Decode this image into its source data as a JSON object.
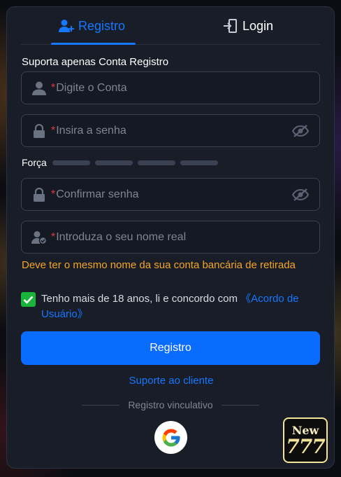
{
  "tabs": [
    {
      "label": "Registro",
      "icon": "user-add-icon",
      "active": true
    },
    {
      "label": "Login",
      "icon": "login-door-icon",
      "active": false
    }
  ],
  "form": {
    "section_label": "Suporta apenas Conta Registro",
    "required_mark": "*",
    "account_placeholder": "Digite o Conta",
    "password_placeholder": "Insira a senha",
    "strength_label": "Força",
    "confirm_placeholder": "Confirmar senha",
    "realname_placeholder": "Introduza o seu nome real",
    "realname_warning": "Deve ter o mesmo nome da sua conta bancária de retirada"
  },
  "agreement": {
    "checked": true,
    "text": "Tenho mais de 18 anos, li e concordo com ",
    "link": "《Acordo de Usuário》"
  },
  "actions": {
    "submit_label": "Registro",
    "support_link": "Suporte ao cliente",
    "divider_text": "Registro vinculativo"
  },
  "badge": {
    "line1": "New",
    "line2": "777"
  },
  "colors": {
    "accent": "#1677ff",
    "button": "#0a6cff",
    "warning": "#f5a623",
    "checkbox": "#19b43a",
    "panel": "#181d28"
  }
}
